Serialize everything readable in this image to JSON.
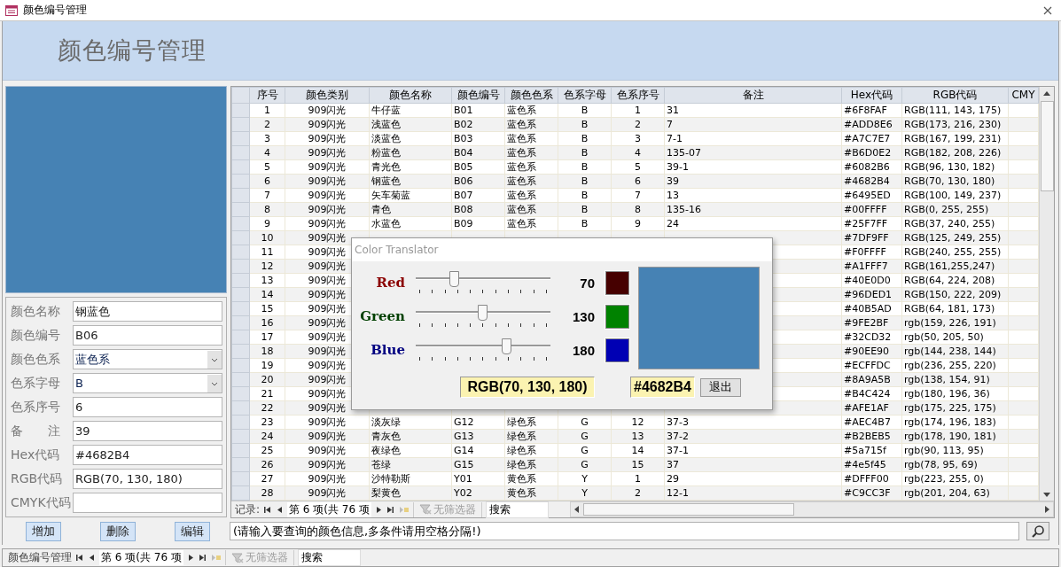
{
  "window": {
    "title": "颜色编号管理"
  },
  "banner": {
    "title": "颜色编号管理"
  },
  "preview": {
    "color": "#4682B4"
  },
  "form": [
    {
      "kind": "text",
      "label": "颜色名称",
      "value": "钢蓝色"
    },
    {
      "kind": "text",
      "label": "颜色编号",
      "value": "B06"
    },
    {
      "kind": "select",
      "label": "颜色色系",
      "value": "蓝色系"
    },
    {
      "kind": "select",
      "label": "色系字母",
      "value": "B"
    },
    {
      "kind": "text",
      "label": "色系序号",
      "value": "6"
    },
    {
      "kind": "text",
      "label": "备　　注",
      "value": "39"
    },
    {
      "kind": "text",
      "label": "Hex代码",
      "value": "#4682B4"
    },
    {
      "kind": "text",
      "label": "RGB代码",
      "value": "RGB(70, 130, 180)"
    },
    {
      "kind": "text",
      "label": "CMYK代码"
    }
  ],
  "buttons": [
    "增加",
    "删除",
    "编辑"
  ],
  "search": {
    "value": "(请输入要查询的颜色信息,多条件请用空格分隔!)"
  },
  "table": {
    "columns": [
      "序号",
      "颜色类别",
      "颜色名称",
      "颜色编号",
      "颜色色系",
      "色系字母",
      "色系序号",
      "备注",
      "Hex代码",
      "RGB代码",
      "CMY"
    ],
    "rows": [
      [
        "1",
        "909闪光",
        "牛仔蓝",
        "B01",
        "蓝色系",
        "B",
        "1",
        "31",
        "#6F8FAF",
        "RGB(111, 143, 175)"
      ],
      [
        "2",
        "909闪光",
        "浅蓝色",
        "B02",
        "蓝色系",
        "B",
        "2",
        "7",
        "#ADD8E6",
        "RGB(173, 216, 230)"
      ],
      [
        "3",
        "909闪光",
        "淡蓝色",
        "B03",
        "蓝色系",
        "B",
        "3",
        "7-1",
        "#A7C7E7",
        "RGB(167, 199, 231)"
      ],
      [
        "4",
        "909闪光",
        "粉蓝色",
        "B04",
        "蓝色系",
        "B",
        "4",
        "135-07",
        "#B6D0E2",
        "RGB(182, 208, 226)"
      ],
      [
        "5",
        "909闪光",
        "青光色",
        "B05",
        "蓝色系",
        "B",
        "5",
        "39-1",
        "#6082B6",
        "RGB(96, 130, 182)"
      ],
      [
        "6",
        "909闪光",
        "钢蓝色",
        "B06",
        "蓝色系",
        "B",
        "6",
        "39",
        "#4682B4",
        "RGB(70, 130, 180)"
      ],
      [
        "7",
        "909闪光",
        "矢车菊蓝",
        "B07",
        "蓝色系",
        "B",
        "7",
        "13",
        "#6495ED",
        "RGB(100, 149, 237)"
      ],
      [
        "8",
        "909闪光",
        "青色",
        "B08",
        "蓝色系",
        "B",
        "8",
        "135-16",
        "#00FFFF",
        "RGB(0, 255, 255)"
      ],
      [
        "9",
        "909闪光",
        "水蓝色",
        "B09",
        "蓝色系",
        "B",
        "9",
        "24",
        "#25F7FF",
        "RGB(37, 240, 255)"
      ],
      [
        "10",
        "909闪光",
        null,
        null,
        null,
        null,
        null,
        null,
        "#7DF9FF",
        "RGB(125, 249, 255)"
      ],
      [
        "11",
        "909闪光",
        null,
        null,
        null,
        null,
        null,
        null,
        "#F0FFFF",
        "RGB(240, 255, 255)"
      ],
      [
        "12",
        "909闪光",
        null,
        null,
        null,
        null,
        null,
        null,
        "#A1FFF7",
        "RGB(161,255,247)"
      ],
      [
        "13",
        "909闪光",
        null,
        null,
        null,
        null,
        null,
        null,
        "#40E0D0",
        "RGB(64, 224, 208)"
      ],
      [
        "14",
        "909闪光",
        null,
        null,
        null,
        null,
        null,
        null,
        "#96DED1",
        "RGB(150, 222, 209)"
      ],
      [
        "15",
        "909闪光",
        null,
        null,
        null,
        null,
        null,
        null,
        "#40B5AD",
        "RGB(64, 181, 173)"
      ],
      [
        "16",
        "909闪光",
        null,
        null,
        null,
        null,
        null,
        null,
        "#9FE2BF",
        "rgb(159, 226, 191)"
      ],
      [
        "17",
        "909闪光",
        null,
        null,
        null,
        null,
        null,
        null,
        "#32CD32",
        "rgb(50, 205, 50)"
      ],
      [
        "18",
        "909闪光",
        null,
        null,
        null,
        null,
        null,
        null,
        "#90EE90",
        "rgb(144, 238, 144)"
      ],
      [
        "19",
        "909闪光",
        null,
        null,
        null,
        null,
        null,
        null,
        "#ECFFDC",
        "rgb(236, 255, 220)"
      ],
      [
        "20",
        "909闪光",
        null,
        null,
        null,
        null,
        null,
        null,
        "#8A9A5B",
        "rgb(138, 154, 91)"
      ],
      [
        "21",
        "909闪光",
        null,
        null,
        null,
        null,
        null,
        null,
        "#B4C424",
        "rgb(180, 196, 36)"
      ],
      [
        "22",
        "909闪光",
        null,
        null,
        null,
        null,
        null,
        null,
        "#AFE1AF",
        "rgb(175, 225, 175)"
      ],
      [
        "23",
        "909闪光",
        "淡灰绿",
        "G12",
        "绿色系",
        "G",
        "12",
        "37-3",
        "#AEC4B7",
        "rgb(174, 196, 183)"
      ],
      [
        "24",
        "909闪光",
        "青灰色",
        "G13",
        "绿色系",
        "G",
        "13",
        "37-2",
        "#B2BEB5",
        "rgb(178, 190, 181)"
      ],
      [
        "25",
        "909闪光",
        "夜绿色",
        "G14",
        "绿色系",
        "G",
        "14",
        "37-1",
        "#5a715f",
        "rgb(90, 113, 95)"
      ],
      [
        "26",
        "909闪光",
        "苍绿",
        "G15",
        "绿色系",
        "G",
        "15",
        "37",
        "#4e5f45",
        "rgb(78, 95, 69)"
      ],
      [
        "27",
        "909闪光",
        "沙特勒斯",
        "Y01",
        "黄色系",
        "Y",
        "1",
        "29",
        "#DFFF00",
        "rgb(223, 255, 0)"
      ],
      [
        "28",
        "909闪光",
        "梨黄色",
        "Y02",
        "黄色系",
        "Y",
        "2",
        "12-1",
        "#C9CC3F",
        "rgb(201, 204, 63)"
      ]
    ]
  },
  "table_nav": {
    "label": "记录:",
    "record": "第 6 项(共 76 项",
    "filter": "无筛选器",
    "search": "搜索"
  },
  "status_bar": {
    "form_name": "颜色编号管理",
    "record": "第 6 项(共 76 项",
    "filter": "无筛选器",
    "search": "搜索"
  },
  "dialog": {
    "title": "Color Translator",
    "channels": [
      {
        "kind": "red",
        "name": "Red",
        "color": "#8b0000",
        "level": 0.2745,
        "reading": "70"
      },
      {
        "kind": "green",
        "name": "Green",
        "color": "#004000",
        "level": 0.5098,
        "reading": "130"
      },
      {
        "kind": "blue",
        "name": "Blue",
        "color": "#000080",
        "level": 0.7059,
        "reading": "180"
      }
    ],
    "rgb_text": "RGB(70, 130, 180)",
    "hex_text": "#4682B4",
    "exit_button": "退出"
  }
}
